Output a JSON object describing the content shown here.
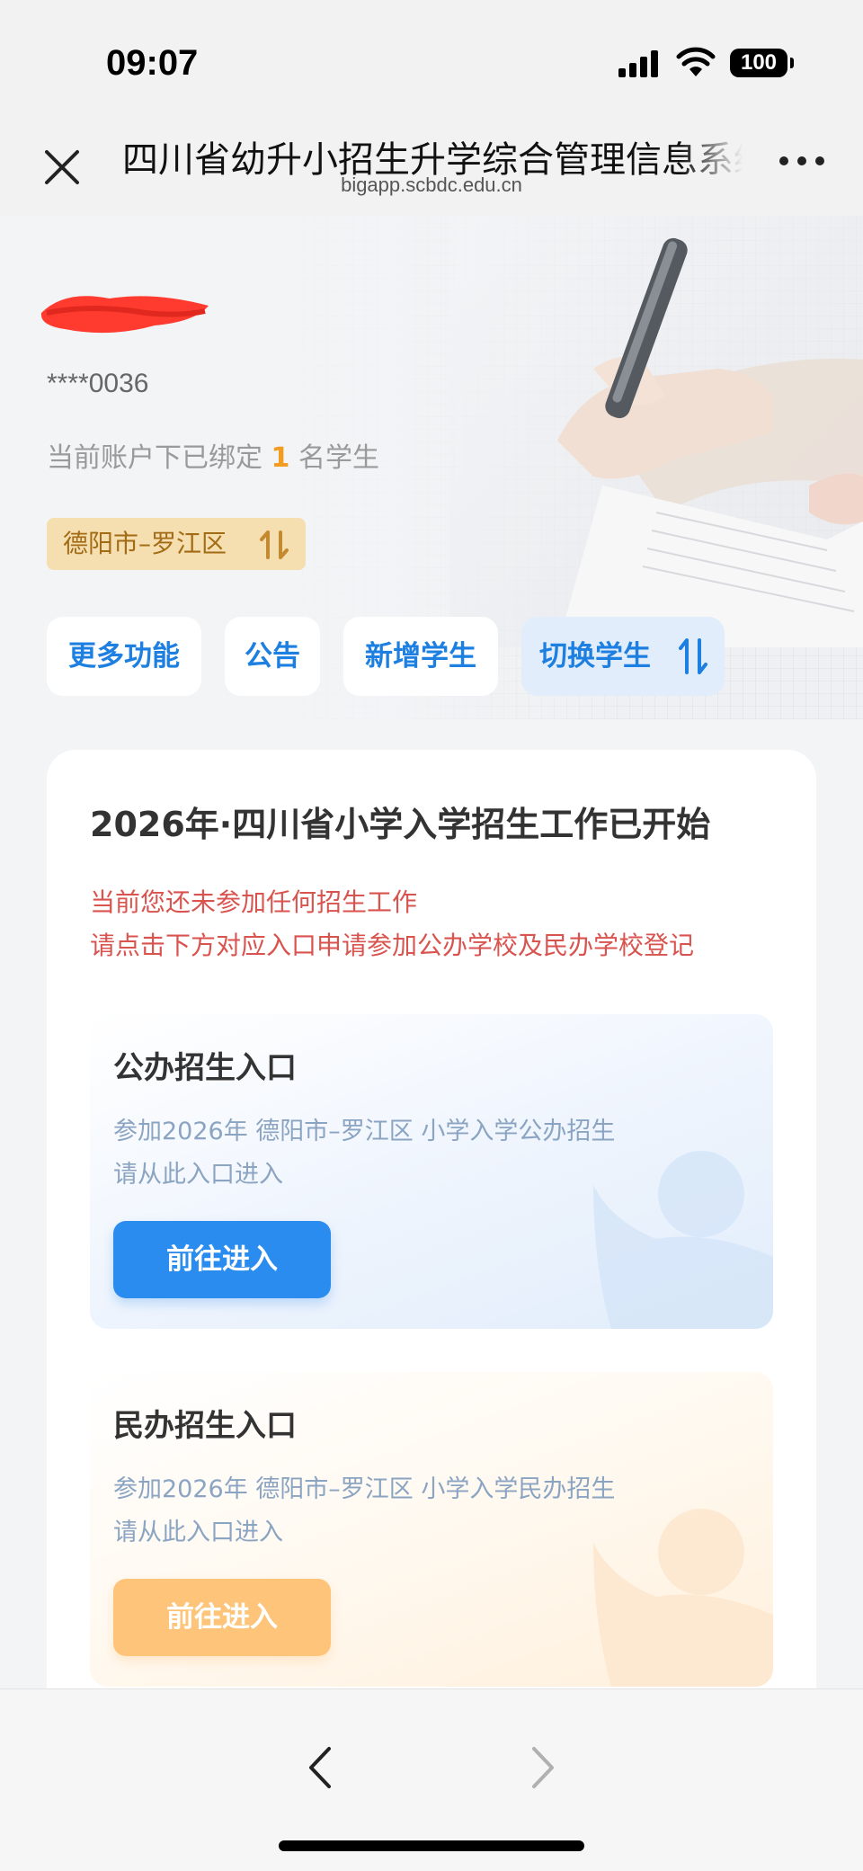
{
  "status_bar": {
    "time": "09:07",
    "battery": "100"
  },
  "navbar": {
    "title": "四川省幼升小招生升学综合管理信息系统",
    "url": "bigapp.scbdc.edu.cn"
  },
  "profile": {
    "masked_phone": "****0036",
    "bound_prefix": "当前账户下已绑定",
    "bound_count": "1",
    "bound_suffix": "名学生",
    "district": "德阳市–罗江区"
  },
  "actions": {
    "more": "更多功能",
    "notice": "公告",
    "add_student": "新增学生",
    "switch_student": "切换学生"
  },
  "card": {
    "title": "2026年·四川省小学入学招生工作已开始",
    "notice_line1": "当前您还未参加任何招生工作",
    "notice_line2": "请点击下方对应入口申请参加公办学校及民办学校登记"
  },
  "public_entry": {
    "title": "公办招生入口",
    "desc_line1": "参加2026年 德阳市–罗江区 小学入学公办招生",
    "desc_line2": "请从此入口进入",
    "button": "前往进入"
  },
  "private_entry": {
    "title": "民办招生入口",
    "desc_line1": "参加2026年 德阳市–罗江区 小学入学民办招生",
    "desc_line2": "请从此入口进入",
    "button": "前往进入"
  },
  "colors": {
    "primary_blue": "#2b8cf0",
    "accent_orange": "#fec57a",
    "notice_red": "#d9534f",
    "district_bg": "#f5deb0"
  },
  "icons": [
    "signal-icon",
    "wifi-icon",
    "close-icon",
    "more-icon",
    "swap-icon",
    "back-icon",
    "forward-icon"
  ]
}
